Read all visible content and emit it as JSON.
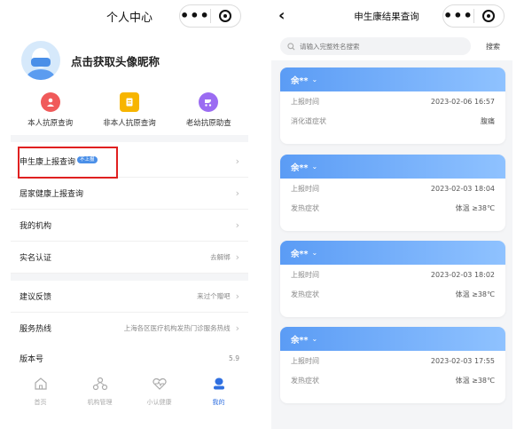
{
  "left": {
    "title": "个人中心",
    "profile_prompt": "点击获取头像昵称",
    "shortcuts": [
      {
        "label": "本人抗原查询",
        "icon": "user-icon",
        "color": "#f05a5a"
      },
      {
        "label": "非本人抗原查询",
        "icon": "document-icon",
        "color": "#f7b500"
      },
      {
        "label": "老幼抗原助查",
        "icon": "stroller-icon",
        "color": "#9b6cf2"
      }
    ],
    "menu": [
      {
        "label": "申生康上报查询",
        "badge": "不上报",
        "value": ""
      },
      {
        "label": "居家健康上报查询",
        "value": ""
      },
      {
        "label": "我的机构",
        "value": ""
      },
      {
        "label": "实名认证",
        "value": "去解绑"
      },
      {
        "label": "建议反馈",
        "value": "来过个赠吧"
      },
      {
        "label": "服务热线",
        "value": "上海各区医疗机构发热门诊服务热线"
      },
      {
        "label": "版本号",
        "value": "5.9"
      }
    ],
    "tabs": [
      {
        "label": "首页",
        "icon": "home-icon",
        "active": false
      },
      {
        "label": "机构管理",
        "icon": "org-icon",
        "active": false
      },
      {
        "label": "小认健康",
        "icon": "heart-icon",
        "active": false
      },
      {
        "label": "我的",
        "icon": "profile-icon",
        "active": true
      }
    ]
  },
  "right": {
    "title": "申生康结果查询",
    "search": {
      "placeholder": "请输入完整姓名搜索",
      "button": "搜索"
    },
    "records": [
      {
        "name": "余**",
        "time_label": "上报时间",
        "time": "2023-02-06 16:57",
        "symptom_label": "消化道症状",
        "symptom": "腹痛"
      },
      {
        "name": "余**",
        "time_label": "上报时间",
        "time": "2023-02-03 18:04",
        "symptom_label": "发热症状",
        "symptom": "体温 ≥38℃"
      },
      {
        "name": "余**",
        "time_label": "上报时间",
        "time": "2023-02-03 18:02",
        "symptom_label": "发热症状",
        "symptom": "体温 ≥38℃"
      },
      {
        "name": "余**",
        "time_label": "上报时间",
        "time": "2023-02-03 17:55",
        "symptom_label": "发热症状",
        "symptom": "体温 ≥38℃"
      }
    ]
  },
  "colors": {
    "accent": "#2f6fe0",
    "card_header_start": "#5b9cf5",
    "card_header_end": "#8fc2ff",
    "highlight": "#e02020"
  }
}
